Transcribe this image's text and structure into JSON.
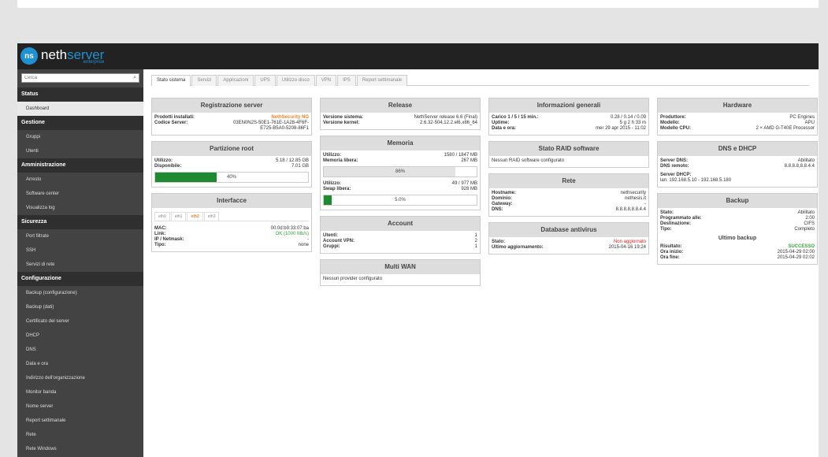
{
  "brand": {
    "logo_mark": "ns",
    "name_part1": "neth",
    "name_part2": "server",
    "subtitle": "enterprise"
  },
  "colors": {
    "brand_blue": "#1f90d2",
    "warning_orange": "#e8872c",
    "error_red": "#d9231c",
    "success_green": "#37a23b",
    "bar_green": "#1d8a2f"
  },
  "sidebar": {
    "search_placeholder": "Cerca",
    "search_icon": "search-icon",
    "sections": [
      {
        "title": "Status",
        "items": [
          "Dashboard"
        ]
      },
      {
        "title": "Gestione",
        "items": [
          "Gruppi",
          "Utenti"
        ]
      },
      {
        "title": "Amministrazione",
        "items": [
          "Arresto",
          "Software center",
          "Visualizza log"
        ]
      },
      {
        "title": "Sicurezza",
        "items": [
          "Port filtrate",
          "SSH",
          "Servizi di rete"
        ]
      },
      {
        "title": "Configurazione",
        "items": [
          "Backup (configurazione)",
          "Backup (dati)",
          "Certificato del server",
          "DHCP",
          "DNS",
          "Data e ora",
          "Indirizzo dell'organizzazione",
          "Monitor banda",
          "Nome server",
          "Report settimanale",
          "Rete",
          "Rete Windows"
        ]
      }
    ]
  },
  "tabs": [
    "Stato sistema",
    "Servizi",
    "Applicazioni",
    "UPS",
    "Utilizzo disco",
    "VPN",
    "IPS",
    "Report settimanale"
  ],
  "panels": {
    "registration": {
      "title": "Registrazione server",
      "products_label": "Prodotti installati:",
      "products_value": "NethSecurity NG",
      "code_label": "Codice Server:",
      "code_value_1": "03EN0N2S-50E1-761E-1A28-4F6F-",
      "code_value_2": "E725-B5A0-5208-86F1"
    },
    "root_partition": {
      "title": "Partizione root",
      "used_label": "Utilizzo:",
      "used_value": "5.18 / 12.85 GB",
      "free_label": "Disponibile:",
      "free_value": "7.01 GB",
      "bar_percent": 40,
      "bar_text": "40%"
    },
    "interfaces": {
      "title": "Interfacce",
      "tabs": [
        "eth0",
        "eth1",
        "eth2",
        "eth3"
      ],
      "active_tab": 2,
      "mac_label": "MAC:",
      "mac_value": "00:0d:b9:33:07:ba",
      "link_label": "Link:",
      "link_value": "OK (1000 Mb/s)",
      "ip_label": "IP / Netmask:",
      "ip_value": "-",
      "type_label": "Tipo:",
      "type_value": "none"
    },
    "release": {
      "title": "Release",
      "version_label": "Versione sistema:",
      "version_value": "NethServer release 6.6 (Final)",
      "kernel_label": "Versione kernel:",
      "kernel_value": "2.6.32-504.12.2.el6.x86_64"
    },
    "memory": {
      "title": "Memoria",
      "used_label": "Utilizzo:",
      "used_value": "1580 / 1847 MB",
      "free_label": "Memoria libera:",
      "free_value": "267 MB",
      "bar1_percent": 86,
      "bar1_text": "86%",
      "swap_used_label": "Utilizzo:",
      "swap_used_value": "49 / 977 MB",
      "swap_free_label": "Swap libera:",
      "swap_free_value": "928 MB",
      "bar2_percent": 5,
      "bar2_text": "5.0%"
    },
    "account": {
      "title": "Account",
      "users_label": "Utenti:",
      "users_value": "1",
      "vpn_label": "Account VPN:",
      "vpn_value": "2",
      "groups_label": "Gruppi:",
      "groups_value": "1"
    },
    "multiwan": {
      "title": "Multi WAN",
      "text": "Nessun provider configurato"
    },
    "general_info": {
      "title": "Informazioni generali",
      "load_label": "Carico 1 / 5 / 15 min.:",
      "load_value": "0.28 / 0.14 / 0.09",
      "uptime_label": "Uptime:",
      "uptime_value": "5 g 2 h 33 m",
      "date_label": "Data e ora:",
      "date_value": "mer 29 apr 2015 - 11:02"
    },
    "raid": {
      "title": "Stato RAID software",
      "text": "Nessun RAID software configurato"
    },
    "network": {
      "title": "Rete",
      "hostname_label": "Hostname:",
      "hostname_value": "nethsecurity",
      "domain_label": "Dominio:",
      "domain_value": "nethesis.it",
      "gateway_label": "Gateway:",
      "gateway_value": "-",
      "dns_label": "DNS:",
      "dns_value": "8.8.8.8,8.8.4.4"
    },
    "antivirus": {
      "title": "Database antivirus",
      "status_label": "Stato:",
      "status_value": "Non aggiornato",
      "update_label": "Ultimo aggiornamento:",
      "update_value": "2015-04-16 19:24"
    },
    "hardware": {
      "title": "Hardware",
      "vendor_label": "Produttore:",
      "vendor_value": "PC Engines",
      "model_label": "Modello:",
      "model_value": "APU",
      "cpu_label": "Modello CPU:",
      "cpu_value": "2 × AMD G-T40E Processor"
    },
    "dns_dhcp": {
      "title": "DNS e DHCP",
      "dns_server_label": "Server DNS:",
      "dns_server_value": "Abilitato",
      "dns_remote_label": "DNS remoto:",
      "dns_remote_value": "8.8.8.8,8.8.4.4",
      "dhcp_label": "Server DHCP:",
      "dhcp_value": "lan: 192.168.5.10 - 192.168.5.180"
    },
    "backup": {
      "title": "Backup",
      "state_label": "Stato:",
      "state_value": "Abilitato",
      "scheduled_label": "Programmato alle:",
      "scheduled_value": "2:00",
      "dest_label": "Destinazione:",
      "dest_value": "CIFS",
      "type_label": "Tipo:",
      "type_value": "Completo",
      "last_title": "Ultimo backup",
      "result_label": "Risultato:",
      "result_value": "SUCCESSO",
      "start_label": "Ora inizio:",
      "start_value": "2015-04-29 02:00",
      "end_label": "Ora fine:",
      "end_value": "2015-04-29 02:02"
    }
  }
}
